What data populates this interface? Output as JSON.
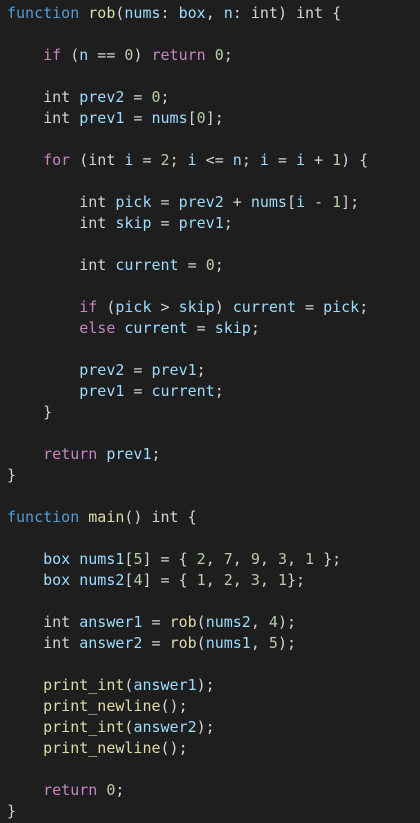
{
  "editor": {
    "theme": {
      "background": "#1e1e1e",
      "keyword_blue": "#569cd6",
      "keyword_pink": "#c586c0",
      "function": "#dcdcaa",
      "identifier": "#9cdcfe",
      "number": "#b5cea8",
      "punctuation": "#d4d4d4"
    },
    "lines": [
      [
        [
          "kw",
          "function"
        ],
        [
          "op",
          " "
        ],
        [
          "fn",
          "rob"
        ],
        [
          "op",
          "("
        ],
        [
          "id",
          "nums"
        ],
        [
          "op",
          ": "
        ],
        [
          "id",
          "box"
        ],
        [
          "op",
          ", "
        ],
        [
          "id",
          "n"
        ],
        [
          "op",
          ": "
        ],
        [
          "ty",
          "int"
        ],
        [
          "op",
          ") "
        ],
        [
          "ty",
          "int"
        ],
        [
          "op",
          " {"
        ]
      ],
      [],
      [
        [
          "op",
          "    "
        ],
        [
          "kwp",
          "if"
        ],
        [
          "op",
          " ("
        ],
        [
          "id",
          "n"
        ],
        [
          "op",
          " == "
        ],
        [
          "num",
          "0"
        ],
        [
          "op",
          ") "
        ],
        [
          "kwp",
          "return"
        ],
        [
          "op",
          " "
        ],
        [
          "num",
          "0"
        ],
        [
          "op",
          ";"
        ]
      ],
      [],
      [
        [
          "op",
          "    "
        ],
        [
          "ty",
          "int"
        ],
        [
          "op",
          " "
        ],
        [
          "id",
          "prev2"
        ],
        [
          "op",
          " = "
        ],
        [
          "num",
          "0"
        ],
        [
          "op",
          ";"
        ]
      ],
      [
        [
          "op",
          "    "
        ],
        [
          "ty",
          "int"
        ],
        [
          "op",
          " "
        ],
        [
          "id",
          "prev1"
        ],
        [
          "op",
          " = "
        ],
        [
          "id",
          "nums"
        ],
        [
          "op",
          "["
        ],
        [
          "num",
          "0"
        ],
        [
          "op",
          "];"
        ]
      ],
      [],
      [
        [
          "op",
          "    "
        ],
        [
          "kwp",
          "for"
        ],
        [
          "op",
          " ("
        ],
        [
          "ty",
          "int"
        ],
        [
          "op",
          " "
        ],
        [
          "id",
          "i"
        ],
        [
          "op",
          " = "
        ],
        [
          "num",
          "2"
        ],
        [
          "op",
          "; "
        ],
        [
          "id",
          "i"
        ],
        [
          "op",
          " <= "
        ],
        [
          "id",
          "n"
        ],
        [
          "op",
          "; "
        ],
        [
          "id",
          "i"
        ],
        [
          "op",
          " = "
        ],
        [
          "id",
          "i"
        ],
        [
          "op",
          " + "
        ],
        [
          "num",
          "1"
        ],
        [
          "op",
          ") {"
        ]
      ],
      [],
      [
        [
          "op",
          "        "
        ],
        [
          "ty",
          "int"
        ],
        [
          "op",
          " "
        ],
        [
          "id",
          "pick"
        ],
        [
          "op",
          " = "
        ],
        [
          "id",
          "prev2"
        ],
        [
          "op",
          " + "
        ],
        [
          "id",
          "nums"
        ],
        [
          "op",
          "["
        ],
        [
          "id",
          "i"
        ],
        [
          "op",
          " - "
        ],
        [
          "num",
          "1"
        ],
        [
          "op",
          "];"
        ]
      ],
      [
        [
          "op",
          "        "
        ],
        [
          "ty",
          "int"
        ],
        [
          "op",
          " "
        ],
        [
          "id",
          "skip"
        ],
        [
          "op",
          " = "
        ],
        [
          "id",
          "prev1"
        ],
        [
          "op",
          ";"
        ]
      ],
      [],
      [
        [
          "op",
          "        "
        ],
        [
          "ty",
          "int"
        ],
        [
          "op",
          " "
        ],
        [
          "id",
          "current"
        ],
        [
          "op",
          " = "
        ],
        [
          "num",
          "0"
        ],
        [
          "op",
          ";"
        ]
      ],
      [],
      [
        [
          "op",
          "        "
        ],
        [
          "kwp",
          "if"
        ],
        [
          "op",
          " ("
        ],
        [
          "id",
          "pick"
        ],
        [
          "op",
          " > "
        ],
        [
          "id",
          "skip"
        ],
        [
          "op",
          ") "
        ],
        [
          "id",
          "current"
        ],
        [
          "op",
          " = "
        ],
        [
          "id",
          "pick"
        ],
        [
          "op",
          ";"
        ]
      ],
      [
        [
          "op",
          "        "
        ],
        [
          "kwp",
          "else"
        ],
        [
          "op",
          " "
        ],
        [
          "id",
          "current"
        ],
        [
          "op",
          " = "
        ],
        [
          "id",
          "skip"
        ],
        [
          "op",
          ";"
        ]
      ],
      [],
      [
        [
          "op",
          "        "
        ],
        [
          "id",
          "prev2"
        ],
        [
          "op",
          " = "
        ],
        [
          "id",
          "prev1"
        ],
        [
          "op",
          ";"
        ]
      ],
      [
        [
          "op",
          "        "
        ],
        [
          "id",
          "prev1"
        ],
        [
          "op",
          " = "
        ],
        [
          "id",
          "current"
        ],
        [
          "op",
          ";"
        ]
      ],
      [
        [
          "op",
          "    }"
        ]
      ],
      [],
      [
        [
          "op",
          "    "
        ],
        [
          "kwp",
          "return"
        ],
        [
          "op",
          " "
        ],
        [
          "id",
          "prev1"
        ],
        [
          "op",
          ";"
        ]
      ],
      [
        [
          "op",
          "}"
        ]
      ],
      [],
      [
        [
          "kw",
          "function"
        ],
        [
          "op",
          " "
        ],
        [
          "fn",
          "main"
        ],
        [
          "op",
          "() "
        ],
        [
          "ty",
          "int"
        ],
        [
          "op",
          " {"
        ]
      ],
      [],
      [
        [
          "op",
          "    "
        ],
        [
          "id",
          "box"
        ],
        [
          "op",
          " "
        ],
        [
          "id",
          "nums1"
        ],
        [
          "op",
          "["
        ],
        [
          "num",
          "5"
        ],
        [
          "op",
          "] = { "
        ],
        [
          "num",
          "2"
        ],
        [
          "op",
          ", "
        ],
        [
          "num",
          "7"
        ],
        [
          "op",
          ", "
        ],
        [
          "num",
          "9"
        ],
        [
          "op",
          ", "
        ],
        [
          "num",
          "3"
        ],
        [
          "op",
          ", "
        ],
        [
          "num",
          "1"
        ],
        [
          "op",
          " };"
        ]
      ],
      [
        [
          "op",
          "    "
        ],
        [
          "id",
          "box"
        ],
        [
          "op",
          " "
        ],
        [
          "id",
          "nums2"
        ],
        [
          "op",
          "["
        ],
        [
          "num",
          "4"
        ],
        [
          "op",
          "] = { "
        ],
        [
          "num",
          "1"
        ],
        [
          "op",
          ", "
        ],
        [
          "num",
          "2"
        ],
        [
          "op",
          ", "
        ],
        [
          "num",
          "3"
        ],
        [
          "op",
          ", "
        ],
        [
          "num",
          "1"
        ],
        [
          "op",
          "};"
        ]
      ],
      [],
      [
        [
          "op",
          "    "
        ],
        [
          "ty",
          "int"
        ],
        [
          "op",
          " "
        ],
        [
          "id",
          "answer1"
        ],
        [
          "op",
          " = "
        ],
        [
          "fn",
          "rob"
        ],
        [
          "op",
          "("
        ],
        [
          "id",
          "nums2"
        ],
        [
          "op",
          ", "
        ],
        [
          "num",
          "4"
        ],
        [
          "op",
          ");"
        ]
      ],
      [
        [
          "op",
          "    "
        ],
        [
          "ty",
          "int"
        ],
        [
          "op",
          " "
        ],
        [
          "id",
          "answer2"
        ],
        [
          "op",
          " = "
        ],
        [
          "fn",
          "rob"
        ],
        [
          "op",
          "("
        ],
        [
          "id",
          "nums1"
        ],
        [
          "op",
          ", "
        ],
        [
          "num",
          "5"
        ],
        [
          "op",
          ");"
        ]
      ],
      [],
      [
        [
          "op",
          "    "
        ],
        [
          "fn",
          "print_int"
        ],
        [
          "op",
          "("
        ],
        [
          "id",
          "answer1"
        ],
        [
          "op",
          ");"
        ]
      ],
      [
        [
          "op",
          "    "
        ],
        [
          "fn",
          "print_newline"
        ],
        [
          "op",
          "();"
        ]
      ],
      [
        [
          "op",
          "    "
        ],
        [
          "fn",
          "print_int"
        ],
        [
          "op",
          "("
        ],
        [
          "id",
          "answer2"
        ],
        [
          "op",
          ");"
        ]
      ],
      [
        [
          "op",
          "    "
        ],
        [
          "fn",
          "print_newline"
        ],
        [
          "op",
          "();"
        ]
      ],
      [],
      [
        [
          "op",
          "    "
        ],
        [
          "kwp",
          "return"
        ],
        [
          "op",
          " "
        ],
        [
          "num",
          "0"
        ],
        [
          "op",
          ";"
        ]
      ],
      [
        [
          "op",
          "}"
        ]
      ]
    ]
  }
}
